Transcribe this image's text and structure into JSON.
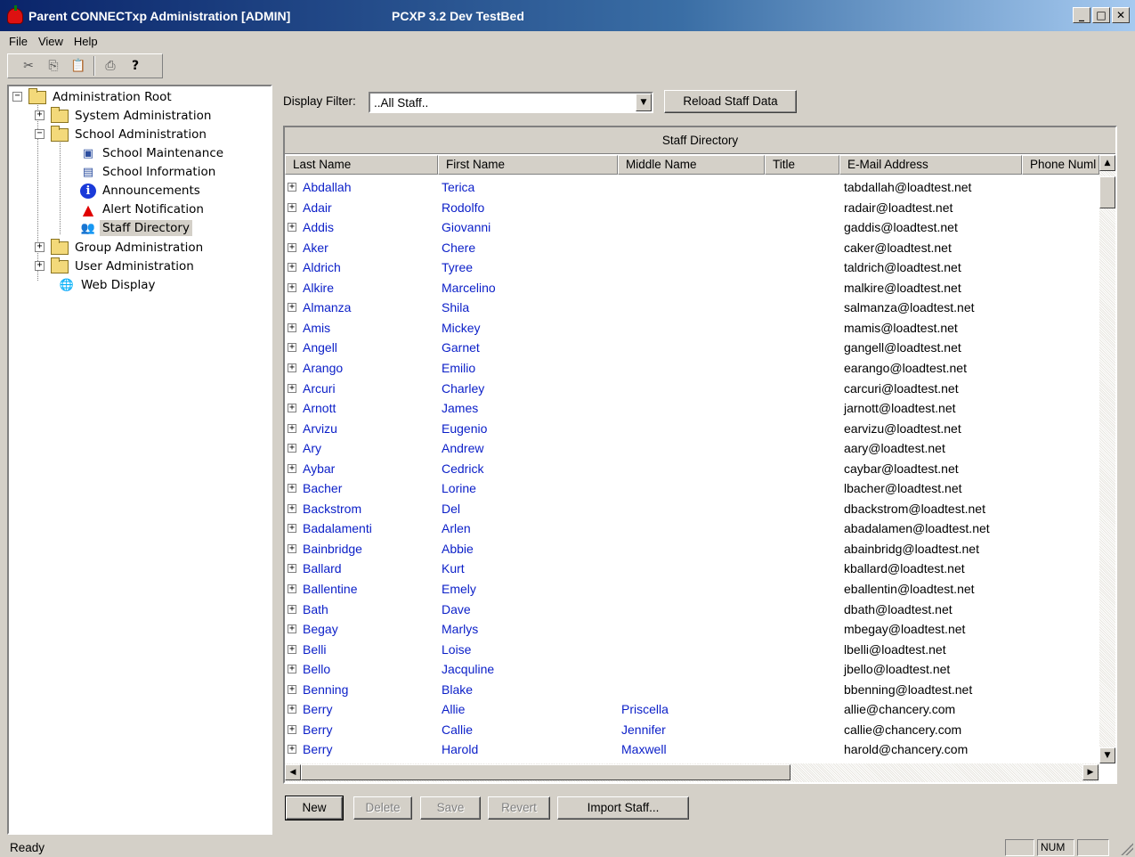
{
  "window": {
    "title": "Parent CONNECTxp Administration [ADMIN]",
    "subtitle": "PCXP 3.2 Dev TestBed",
    "minimize_glyph": "_",
    "maximize_glyph": "□",
    "close_glyph": "✕"
  },
  "menu": [
    "File",
    "View",
    "Help"
  ],
  "toolbar": {
    "icons": [
      "cut-icon",
      "copy-icon",
      "paste-icon",
      "print-icon",
      "help-icon"
    ],
    "glyphs": {
      "cut": "✂",
      "copy": "⎘",
      "paste": "📋",
      "print": "⎙",
      "help": "?"
    }
  },
  "tree": {
    "root": "Administration Root",
    "system_admin": "System Administration",
    "school_admin": "School Administration",
    "school_maintenance": "School Maintenance",
    "school_information": "School Information",
    "announcements": "Announcements",
    "alert_notification": "Alert Notification",
    "staff_directory": "Staff Directory",
    "group_admin": "Group Administration",
    "user_admin": "User Administration",
    "web_display": "Web Display"
  },
  "filter": {
    "label": "Display Filter:",
    "value": "..All Staff..",
    "reload_button": "Reload Staff Data"
  },
  "grid": {
    "caption": "Staff Directory",
    "columns": [
      "Last Name",
      "First Name",
      "Middle Name",
      "Title",
      "E-Mail Address",
      "Phone Numl"
    ],
    "rows": [
      [
        "Abdallah",
        "Terica",
        "",
        "",
        "tabdallah@loadtest.net"
      ],
      [
        "Adair",
        "Rodolfo",
        "",
        "",
        "radair@loadtest.net"
      ],
      [
        "Addis",
        "Giovanni",
        "",
        "",
        "gaddis@loadtest.net"
      ],
      [
        "Aker",
        "Chere",
        "",
        "",
        "caker@loadtest.net"
      ],
      [
        "Aldrich",
        "Tyree",
        "",
        "",
        "taldrich@loadtest.net"
      ],
      [
        "Alkire",
        "Marcelino",
        "",
        "",
        "malkire@loadtest.net"
      ],
      [
        "Almanza",
        "Shila",
        "",
        "",
        "salmanza@loadtest.net"
      ],
      [
        "Amis",
        "Mickey",
        "",
        "",
        "mamis@loadtest.net"
      ],
      [
        "Angell",
        "Garnet",
        "",
        "",
        "gangell@loadtest.net"
      ],
      [
        "Arango",
        "Emilio",
        "",
        "",
        "earango@loadtest.net"
      ],
      [
        "Arcuri",
        "Charley",
        "",
        "",
        "carcuri@loadtest.net"
      ],
      [
        "Arnott",
        "James",
        "",
        "",
        "jarnott@loadtest.net"
      ],
      [
        "Arvizu",
        "Eugenio",
        "",
        "",
        "earvizu@loadtest.net"
      ],
      [
        "Ary",
        "Andrew",
        "",
        "",
        "aary@loadtest.net"
      ],
      [
        "Aybar",
        "Cedrick",
        "",
        "",
        "caybar@loadtest.net"
      ],
      [
        "Bacher",
        "Lorine",
        "",
        "",
        "lbacher@loadtest.net"
      ],
      [
        "Backstrom",
        "Del",
        "",
        "",
        "dbackstrom@loadtest.net"
      ],
      [
        "Badalamenti",
        "Arlen",
        "",
        "",
        "abadalamen@loadtest.net"
      ],
      [
        "Bainbridge",
        "Abbie",
        "",
        "",
        "abainbridg@loadtest.net"
      ],
      [
        "Ballard",
        "Kurt",
        "",
        "",
        "kballard@loadtest.net"
      ],
      [
        "Ballentine",
        "Emely",
        "",
        "",
        "eballentin@loadtest.net"
      ],
      [
        "Bath",
        "Dave",
        "",
        "",
        "dbath@loadtest.net"
      ],
      [
        "Begay",
        "Marlys",
        "",
        "",
        "mbegay@loadtest.net"
      ],
      [
        "Belli",
        "Loise",
        "",
        "",
        "lbelli@loadtest.net"
      ],
      [
        "Bello",
        "Jacquline",
        "",
        "",
        "jbello@loadtest.net"
      ],
      [
        "Benning",
        "Blake",
        "",
        "",
        "bbenning@loadtest.net"
      ],
      [
        "Berry",
        "Allie",
        "Priscella",
        "",
        "allie@chancery.com"
      ],
      [
        "Berry",
        "Callie",
        "Jennifer",
        "",
        "callie@chancery.com"
      ],
      [
        "Berry",
        "Harold",
        "Maxwell",
        "",
        "harold@chancery.com"
      ]
    ]
  },
  "buttons": {
    "new": "New",
    "delete": "Delete",
    "save": "Save",
    "revert": "Revert",
    "import": "Import Staff..."
  },
  "status": {
    "text": "Ready",
    "num": "NUM"
  },
  "colors": {
    "link_text": "#0a1ec8",
    "title_gradient_start": "#0a246a",
    "chrome": "#d4d0c8"
  }
}
